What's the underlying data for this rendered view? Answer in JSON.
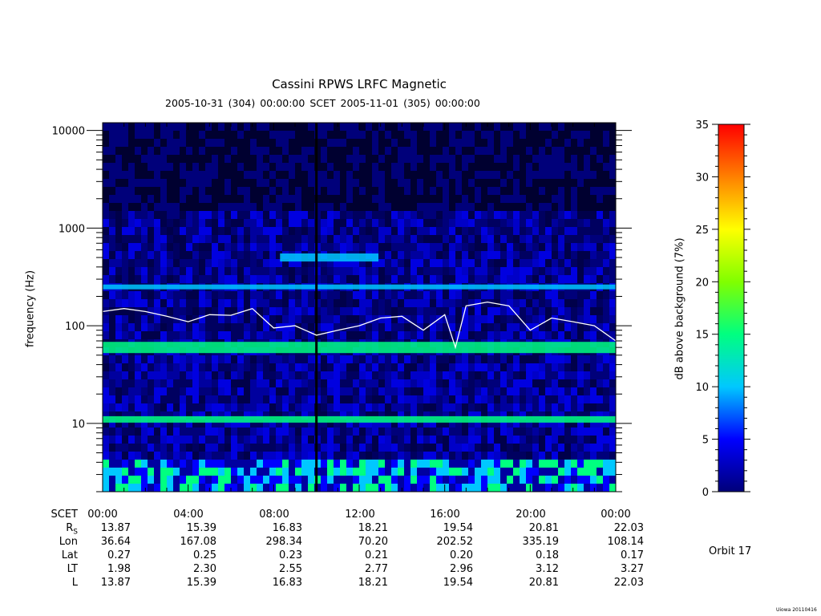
{
  "chart_data": {
    "type": "heatmap",
    "title": "Cassini RPWS LRFC Magnetic",
    "subtitle": "2005-10-31 (304) 00:00:00    SCET    2005-11-01 (305) 00:00:00",
    "ylabel": "frequency (Hz)",
    "colorbar_label": "dB above background (7%)",
    "yscale": "log",
    "ylim": [
      2,
      12000
    ],
    "yticks": [
      10,
      100,
      1000,
      10000
    ],
    "ytick_labels": [
      "10",
      "100",
      "1000",
      "10000"
    ],
    "xlim_hours": [
      0,
      24
    ],
    "colorbar_range": [
      0,
      35
    ],
    "colorbar_ticks": [
      0,
      5,
      10,
      15,
      20,
      25,
      30,
      35
    ],
    "colorbar_tick_labels": [
      "0",
      "5",
      "10",
      "15",
      "20",
      "25",
      "30",
      "35"
    ],
    "colormap": [
      "#00007a",
      "#0000ff",
      "#00c8ff",
      "#00ff80",
      "#80ff00",
      "#ffff00",
      "#ff8000",
      "#ff0000"
    ],
    "annotation_curve_color": "#ffffff",
    "features": [
      {
        "name": "emission band",
        "freq_hz": 250,
        "hours": [
          0,
          24
        ]
      },
      {
        "name": "emission band",
        "freq_hz": 60,
        "hours": [
          0,
          24
        ]
      },
      {
        "name": "emission band",
        "freq_hz": 11,
        "hours": [
          0,
          24
        ]
      },
      {
        "name": "emission band",
        "freq_hz": 500,
        "hours": [
          8.3,
          12.9
        ]
      }
    ],
    "fce_curve": {
      "hours": [
        0,
        1,
        2,
        3,
        4,
        5,
        6,
        7,
        8,
        9,
        10,
        11,
        12,
        13,
        14,
        15,
        16,
        16.5,
        17,
        18,
        19,
        20,
        21,
        22,
        23,
        24
      ],
      "freq_hz": [
        140,
        150,
        140,
        125,
        110,
        130,
        128,
        150,
        95,
        100,
        80,
        90,
        100,
        120,
        125,
        90,
        130,
        60,
        160,
        175,
        160,
        90,
        120,
        110,
        100,
        70
      ]
    }
  },
  "ephemeris": {
    "rows": [
      {
        "label": "SCET",
        "values": [
          "00:00",
          "04:00",
          "08:00",
          "12:00",
          "16:00",
          "20:00",
          "00:00"
        ]
      },
      {
        "label": "R",
        "sub": "S",
        "values": [
          "13.87",
          "15.39",
          "16.83",
          "18.21",
          "19.54",
          "20.81",
          "22.03"
        ]
      },
      {
        "label": "Lon",
        "values": [
          "36.64",
          "167.08",
          "298.34",
          "70.20",
          "202.52",
          "335.19",
          "108.14"
        ]
      },
      {
        "label": "Lat",
        "values": [
          "0.27",
          "0.25",
          "0.23",
          "0.21",
          "0.20",
          "0.18",
          "0.17"
        ]
      },
      {
        "label": "LT",
        "values": [
          "1.98",
          "2.30",
          "2.55",
          "2.77",
          "2.96",
          "3.12",
          "3.27"
        ]
      },
      {
        "label": "L",
        "values": [
          "13.87",
          "15.39",
          "16.83",
          "18.21",
          "19.54",
          "20.81",
          "22.03"
        ]
      }
    ]
  },
  "orbit_label": "Orbit 17",
  "credit": "Uiowa 20110416"
}
